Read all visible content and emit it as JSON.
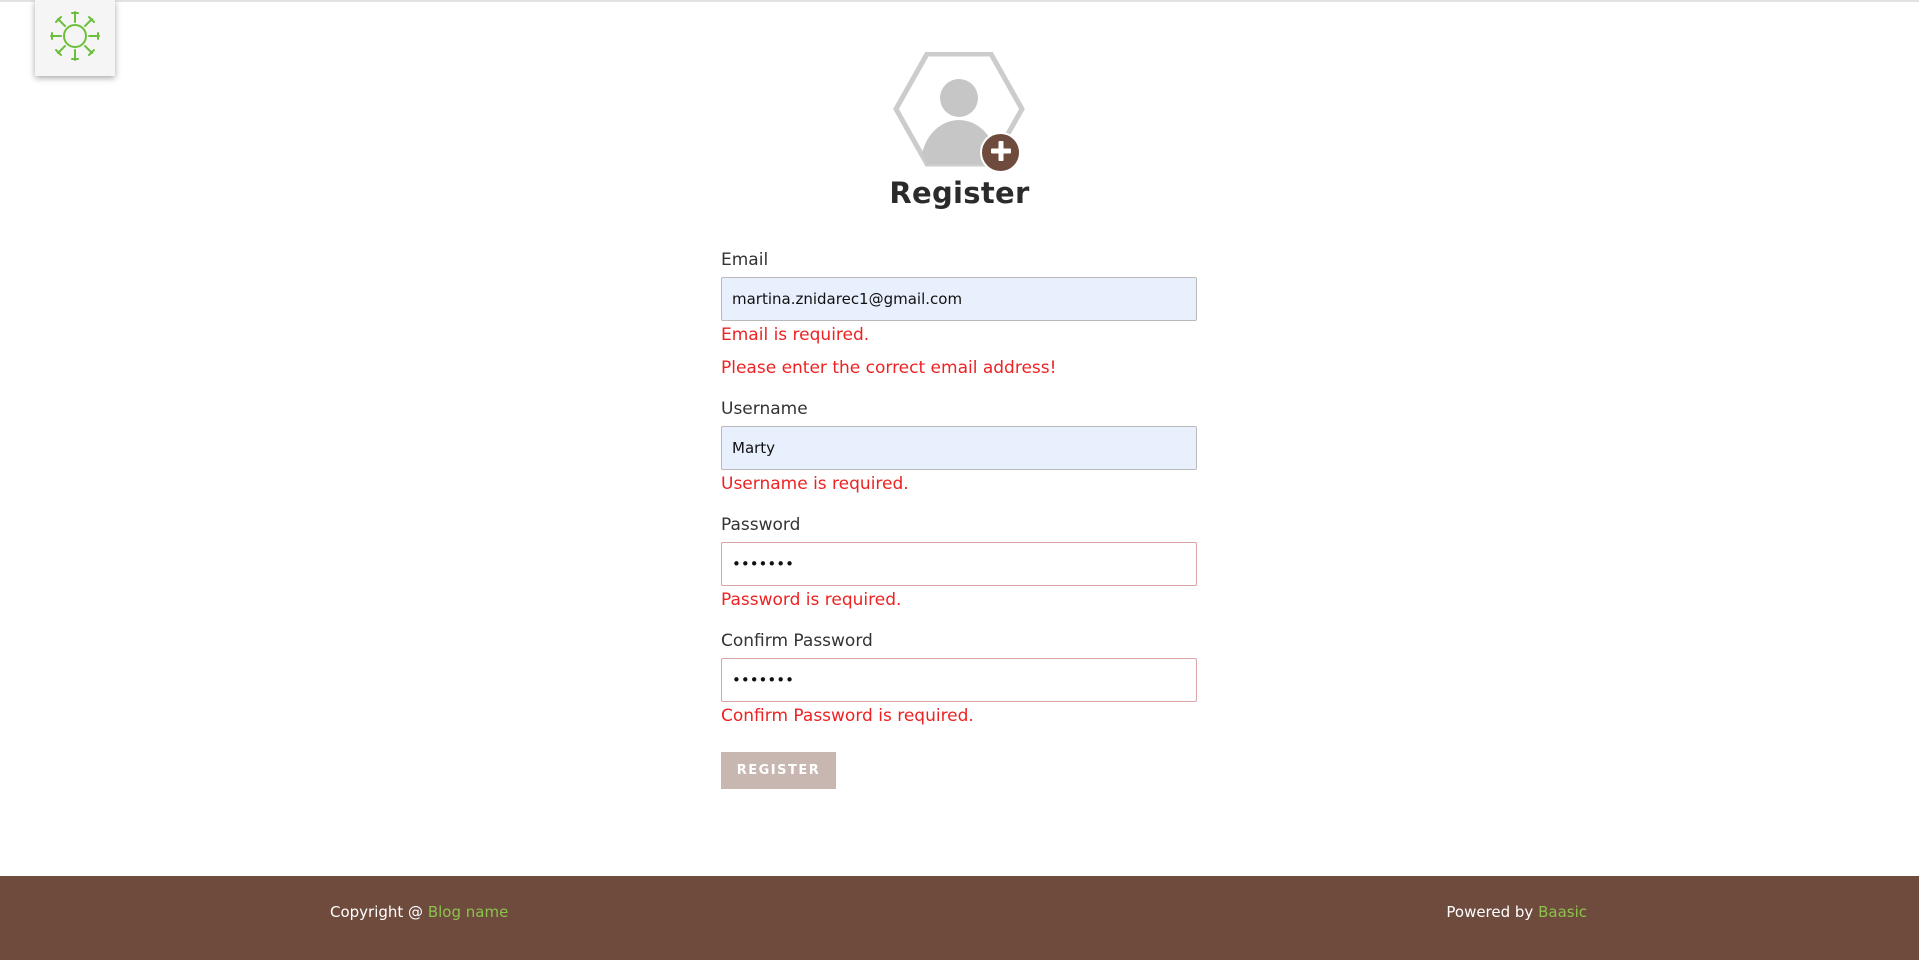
{
  "header": {
    "logo_icon": "sunburst-logo-icon",
    "logo_color": "#6cbf3b"
  },
  "avatar": {
    "icon": "user-avatar-icon",
    "badge_icon": "plus-icon",
    "badge_color": "#6f4b3e"
  },
  "page": {
    "title": "Register"
  },
  "form": {
    "email": {
      "label": "Email",
      "value": "martina.znidarec1@gmail.com",
      "errors": [
        "Email is required.",
        "Please enter the correct email address!"
      ]
    },
    "username": {
      "label": "Username",
      "value": "Marty",
      "errors": [
        "Username is required."
      ]
    },
    "password": {
      "label": "Password",
      "value": "•••••••",
      "errors": [
        "Password is required."
      ]
    },
    "confirm_password": {
      "label": "Confirm Password",
      "value": "•••••••",
      "errors": [
        "Confirm Password is required."
      ]
    },
    "submit_label": "REGISTER",
    "error_color": "#ee2222",
    "button_color": "#c8b6b0"
  },
  "footer": {
    "copyright_text": "Copyright @ ",
    "blog_link": "Blog name",
    "powered_text": "Powered by ",
    "baasic_link": "Baasic",
    "background_color": "#6f4b3e",
    "link_color": "#8bc34a"
  }
}
